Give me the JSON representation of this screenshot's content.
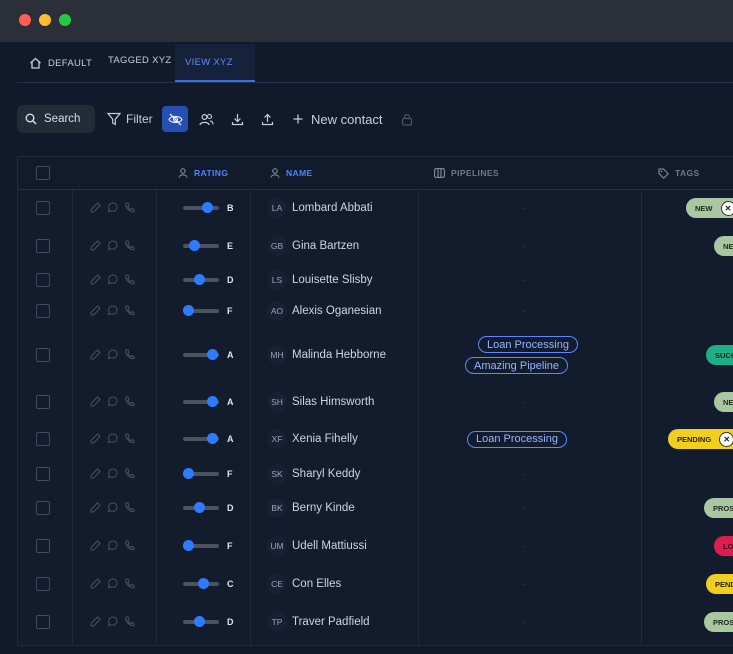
{
  "tabs": [
    {
      "label": "DEFAULT",
      "icon": "home-icon"
    },
    {
      "label": "TAGGED XYZ"
    },
    {
      "label": "VIEW XYZ",
      "active": true
    }
  ],
  "toolbar": {
    "search_label": "Search",
    "filter_label": "Filter",
    "new_contact_label": "New contact"
  },
  "columns": {
    "rating": "RATING",
    "name": "NAME",
    "pipelines": "PIPELINES",
    "tags": "TAGS"
  },
  "colors": {
    "accent": "#2f7bff",
    "tag_new": "#a9c7a0",
    "tag_success": "#1fae86",
    "tag_pending": "#f2cf1f",
    "tag_prospect": "#a9c7a0",
    "tag_lost": "#d81f4f"
  },
  "rows": [
    {
      "initials": "LA",
      "name": "Lombard Abbati",
      "grade": "B",
      "rating": 0.75,
      "pipelines": [],
      "tag": {
        "label": "NEW",
        "close": true
      }
    },
    {
      "initials": "GB",
      "name": "Gina Bartzen",
      "grade": "E",
      "rating": 0.25,
      "pipelines": [],
      "tag": {
        "label": "NEW"
      }
    },
    {
      "initials": "LS",
      "name": "Louisette Slisby",
      "grade": "D",
      "rating": 0.45,
      "pipelines": [],
      "tag": null
    },
    {
      "initials": "AO",
      "name": "Alexis Oganesian",
      "grade": "F",
      "rating": 0.0,
      "pipelines": [],
      "tag": null
    },
    {
      "initials": "MH",
      "name": "Malinda Hebborne",
      "grade": "A",
      "rating": 0.95,
      "pipelines": [
        "Loan Processing",
        "Amazing Pipeline"
      ],
      "tag": {
        "label": "SUCCESS"
      }
    },
    {
      "initials": "SH",
      "name": "Silas Himsworth",
      "grade": "A",
      "rating": 0.95,
      "pipelines": [],
      "tag": {
        "label": "NEW"
      }
    },
    {
      "initials": "XF",
      "name": "Xenia Fihelly",
      "grade": "A",
      "rating": 0.95,
      "pipelines": [
        "Loan Processing"
      ],
      "tag": {
        "label": "PENDING",
        "close": true
      }
    },
    {
      "initials": "SK",
      "name": "Sharyl Keddy",
      "grade": "F",
      "rating": 0.0,
      "pipelines": [],
      "tag": null
    },
    {
      "initials": "BK",
      "name": "Berny Kinde",
      "grade": "D",
      "rating": 0.45,
      "pipelines": [],
      "tag": {
        "label": "PROSPECT"
      }
    },
    {
      "initials": "UM",
      "name": "Udell Mattiussi",
      "grade": "F",
      "rating": 0.0,
      "pipelines": [],
      "tag": {
        "label": "LOST"
      }
    },
    {
      "initials": "CE",
      "name": "Con Elles",
      "grade": "C",
      "rating": 0.6,
      "pipelines": [],
      "tag": {
        "label": "PENDING"
      }
    },
    {
      "initials": "TP",
      "name": "Traver Padfield",
      "grade": "D",
      "rating": 0.45,
      "pipelines": [],
      "tag": {
        "label": "PROSPECT"
      }
    }
  ]
}
